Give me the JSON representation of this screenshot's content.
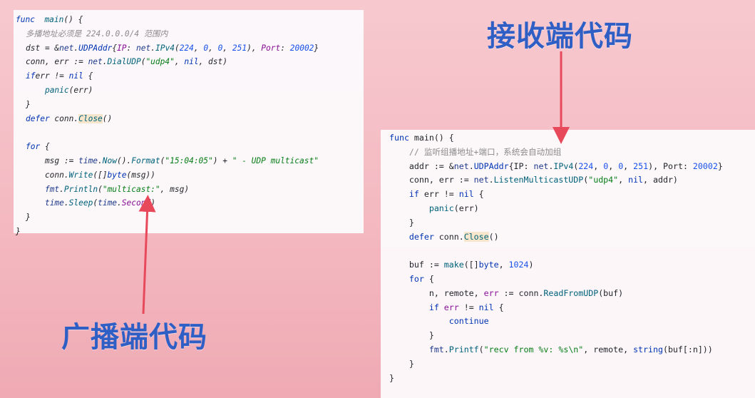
{
  "labels": {
    "receiver": "接收端代码",
    "sender": "广播端代码"
  },
  "sender_code": [
    [
      [
        "kw",
        "func"
      ],
      [
        "",
        "  "
      ],
      [
        "fn",
        "main"
      ],
      [
        "",
        "() {"
      ]
    ],
    [
      [
        "cm",
        "多播地址必须是 224.0.0.0/4 范围内"
      ]
    ],
    [
      [
        "",
        ""
      ],
      [
        "",
        "dst "
      ],
      [
        "",
        "= &"
      ],
      [
        "pkg",
        "net"
      ],
      [
        "",
        "."
      ],
      [
        "typ",
        "UDPAddr"
      ],
      [
        "",
        "{"
      ],
      [
        "field",
        "IP"
      ],
      [
        "",
        ": "
      ],
      [
        "pkg",
        "net"
      ],
      [
        "",
        "."
      ],
      [
        "fn",
        "IPv4"
      ],
      [
        "",
        "("
      ],
      [
        "num",
        "224"
      ],
      [
        "",
        ", "
      ],
      [
        "num",
        "0"
      ],
      [
        "",
        ", "
      ],
      [
        "num",
        "0"
      ],
      [
        "",
        ", "
      ],
      [
        "num",
        "251"
      ],
      [
        "",
        "), "
      ],
      [
        "field",
        "Port"
      ],
      [
        "",
        ": "
      ],
      [
        "num",
        "20002"
      ],
      [
        "",
        "}"
      ]
    ],
    [
      [
        "",
        ""
      ],
      [
        "",
        "conn, err := "
      ],
      [
        "pkg",
        "net"
      ],
      [
        "",
        "."
      ],
      [
        "fn",
        "DialUDP"
      ],
      [
        "",
        "("
      ],
      [
        "str",
        "\"udp4\""
      ],
      [
        "",
        ", "
      ],
      [
        "kw",
        "nil"
      ],
      [
        "",
        ", dst)"
      ]
    ],
    [
      [
        "",
        ""
      ],
      [
        "kw",
        "if"
      ],
      [
        "",
        ""
      ],
      [
        "",
        ""
      ],
      [
        "",
        "err != "
      ],
      [
        "kw",
        "nil"
      ],
      [
        "",
        " {"
      ]
    ],
    [
      [
        "",
        "    "
      ],
      [
        "fn",
        "panic"
      ],
      [
        "",
        "(err)"
      ]
    ],
    [
      [
        "",
        "}"
      ]
    ],
    [
      [
        "kw",
        "defer"
      ],
      [
        "",
        " conn."
      ],
      [
        "fn hl",
        "Close"
      ],
      [
        "",
        "()"
      ]
    ],
    [
      [
        "",
        ""
      ]
    ],
    [
      [
        "kw",
        "for"
      ],
      [
        "",
        " {"
      ]
    ],
    [
      [
        "",
        "    msg := "
      ],
      [
        "pkg",
        "time"
      ],
      [
        "",
        "."
      ],
      [
        "fn",
        "Now"
      ],
      [
        "",
        "()."
      ],
      [
        "fn",
        "Format"
      ],
      [
        "",
        "("
      ],
      [
        "str",
        "\"15:04:05\""
      ],
      [
        "",
        ") + "
      ],
      [
        "str",
        "\" - UDP multicast\""
      ]
    ],
    [
      [
        "",
        "    conn."
      ],
      [
        "fn",
        "Write"
      ],
      [
        "",
        "([]"
      ],
      [
        "typ",
        "byte"
      ],
      [
        "",
        "(msg))"
      ]
    ],
    [
      [
        "",
        "    "
      ],
      [
        "pkg",
        "fmt"
      ],
      [
        "",
        "."
      ],
      [
        "fn",
        "Println"
      ],
      [
        "",
        "("
      ],
      [
        "str",
        "\"multicast:\""
      ],
      [
        "",
        ", msg)"
      ]
    ],
    [
      [
        "",
        "    "
      ],
      [
        "pkg",
        "time"
      ],
      [
        "",
        "."
      ],
      [
        "fn",
        "Sleep"
      ],
      [
        "",
        "("
      ],
      [
        "pkg",
        "time"
      ],
      [
        "",
        "."
      ],
      [
        "field",
        "Second"
      ],
      [
        "",
        ")"
      ]
    ],
    [
      [
        "",
        "}"
      ]
    ],
    [
      [
        "",
        "}"
      ]
    ]
  ],
  "receiver_code": [
    [
      [
        "kw",
        "func"
      ],
      [
        "",
        ""
      ],
      [
        "",
        " main() {"
      ]
    ],
    [
      [
        "",
        "    "
      ],
      [
        "cm",
        "// 监听组播地址+端口，系统会自动加组"
      ]
    ],
    [
      [
        "",
        "    addr := &"
      ],
      [
        "pkg",
        "net"
      ],
      [
        "",
        "."
      ],
      [
        "typ",
        "UDPAddr"
      ],
      [
        "",
        "{IP: "
      ],
      [
        "pkg",
        "net"
      ],
      [
        "",
        "."
      ],
      [
        "fn",
        "IPv4"
      ],
      [
        "",
        "("
      ],
      [
        "num",
        "224"
      ],
      [
        "",
        ", "
      ],
      [
        "num",
        "0"
      ],
      [
        "",
        ", "
      ],
      [
        "num",
        "0"
      ],
      [
        "",
        ", "
      ],
      [
        "num",
        "251"
      ],
      [
        "",
        "), Port: "
      ],
      [
        "num",
        "20002"
      ],
      [
        "",
        "}"
      ]
    ],
    [
      [
        "",
        "    conn, err := "
      ],
      [
        "pkg",
        "net"
      ],
      [
        "",
        "."
      ],
      [
        "fn",
        "ListenMulticastUDP"
      ],
      [
        "",
        "("
      ],
      [
        "str",
        "\"udp4\""
      ],
      [
        "",
        ", "
      ],
      [
        "kw",
        "nil"
      ],
      [
        "",
        ", addr)"
      ]
    ],
    [
      [
        "",
        "    "
      ],
      [
        "kw",
        "if"
      ],
      [
        "",
        " err != "
      ],
      [
        "kw",
        "nil"
      ],
      [
        "",
        " {"
      ]
    ],
    [
      [
        "",
        "        "
      ],
      [
        "fn",
        "panic"
      ],
      [
        "",
        "(err)"
      ]
    ],
    [
      [
        "",
        "    }"
      ]
    ],
    [
      [
        "",
        "    "
      ],
      [
        "kw",
        "defer"
      ],
      [
        "",
        " conn."
      ],
      [
        "fn hl",
        "Close"
      ],
      [
        "",
        "()"
      ]
    ],
    [
      [
        "",
        ""
      ]
    ],
    [
      [
        "",
        "    buf := "
      ],
      [
        "fn",
        "make"
      ],
      [
        "",
        "([]"
      ],
      [
        "typ",
        "byte"
      ],
      [
        "",
        ", "
      ],
      [
        "num",
        "1024"
      ],
      [
        "",
        ")"
      ]
    ],
    [
      [
        "",
        "    "
      ],
      [
        "kw",
        "for"
      ],
      [
        "",
        " {"
      ]
    ],
    [
      [
        "",
        "        n, remote, "
      ],
      [
        "field",
        "err"
      ],
      [
        "",
        " := conn."
      ],
      [
        "fn",
        "ReadFromUDP"
      ],
      [
        "",
        "(buf)"
      ]
    ],
    [
      [
        "",
        "        "
      ],
      [
        "kw",
        "if"
      ],
      [
        "",
        " "
      ],
      [
        "field",
        "err"
      ],
      [
        "",
        " != "
      ],
      [
        "kw",
        "nil"
      ],
      [
        "",
        " {"
      ]
    ],
    [
      [
        "",
        "            "
      ],
      [
        "kw",
        "continue"
      ]
    ],
    [
      [
        "",
        "        }"
      ]
    ],
    [
      [
        "",
        "        "
      ],
      [
        "pkg",
        "fmt"
      ],
      [
        "",
        "."
      ],
      [
        "fn",
        "Printf"
      ],
      [
        "",
        "("
      ],
      [
        "str",
        "\"recv from %v: %s\\n\""
      ],
      [
        "",
        ", remote, "
      ],
      [
        "typ",
        "string"
      ],
      [
        "",
        "(buf[:n]))"
      ]
    ],
    [
      [
        "",
        "    }"
      ]
    ],
    [
      [
        "",
        "}"
      ]
    ]
  ],
  "colors": {
    "arrow": "#e8495a",
    "label": "#2f5fc5"
  }
}
